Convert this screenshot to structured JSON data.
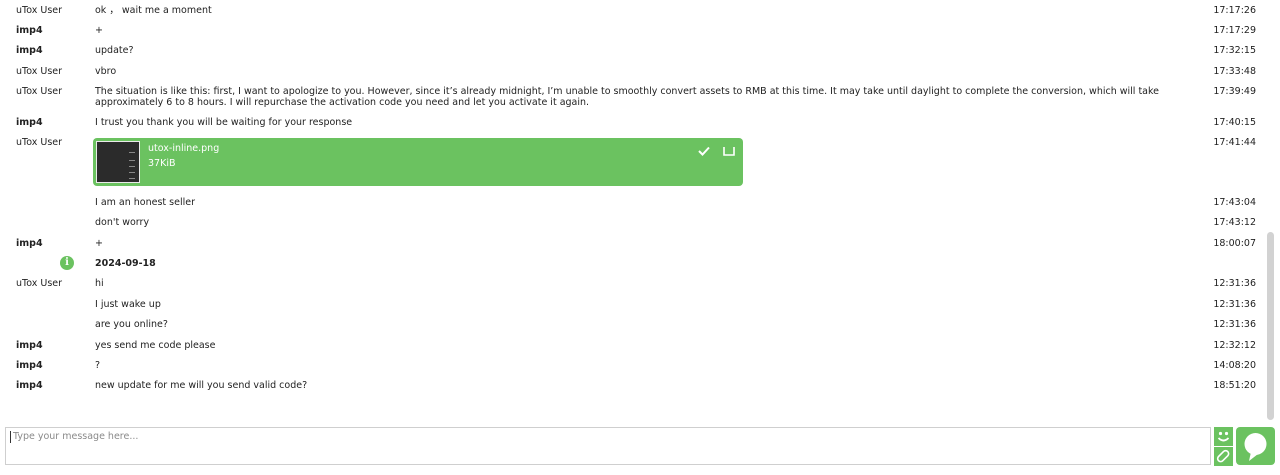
{
  "messages": [
    {
      "author": "uTox User",
      "text": "ok ， wait me a moment",
      "time": "17:17:26"
    },
    {
      "author": "imp4",
      "text": "+",
      "time": "17:17:29"
    },
    {
      "author": "imp4",
      "text": "update?",
      "time": "17:32:15"
    },
    {
      "author": "uTox User",
      "text": "vbro",
      "time": "17:33:48"
    },
    {
      "author": "uTox User",
      "text": "The situation is like this: first, I want to apologize to you. However, since it’s already midnight, I’m unable to smoothly convert assets to RMB at this time. It may take until daylight to complete the conversion, which will take approximately 6 to 8 hours. I will repurchase the activation code you need and let you activate it again.",
      "time": "17:39:49"
    },
    {
      "author": "imp4",
      "text": "I trust you thank you will be waiting for your response",
      "time": "17:40:15"
    },
    {
      "author": "uTox User",
      "time": "17:41:44"
    },
    {
      "author": "",
      "text": " I am an honest seller",
      "time": "17:43:04"
    },
    {
      "author": "",
      "text": "don't worry",
      "time": "17:43:12"
    },
    {
      "author": "imp4",
      "text": "+",
      "time": "18:00:07"
    },
    {
      "author": "uTox User",
      "text": "hi",
      "time": "12:31:36"
    },
    {
      "author": "",
      "text": "I just wake up",
      "time": "12:31:36"
    },
    {
      "author": "",
      "text": "are you online?",
      "time": "12:31:36"
    },
    {
      "author": "imp4",
      "text": "yes send me code please",
      "time": "12:32:12"
    },
    {
      "author": "imp4",
      "text": "?",
      "time": "14:08:20"
    },
    {
      "author": "imp4",
      "text": "new update for me will you send valid code?",
      "time": "18:51:20"
    }
  ],
  "date_separator": "2024-09-18",
  "file_transfer": {
    "name": "utox-inline.png",
    "size": "37KiB"
  },
  "composer": {
    "placeholder": "Type your message here..."
  },
  "colors": {
    "accent": "#6bc260",
    "scrollbar": "#d2d2d2",
    "border": "#cfcfcf"
  },
  "icons": {
    "info": "info-icon",
    "accept": "checkmark-icon",
    "cancel": "cancel-icon",
    "emoji": "smiley-icon",
    "attach": "paperclip-icon",
    "send": "speech-bubble-icon"
  }
}
